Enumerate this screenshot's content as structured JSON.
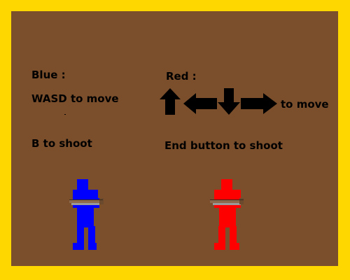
{
  "blue": {
    "heading": "Blue :",
    "move_text": "WASD to move",
    "shoot_text": "B to shoot",
    "color": "#0000FF"
  },
  "red": {
    "heading": "Red :",
    "move_text": "to move",
    "shoot_text": "End button to shoot",
    "color": "#FF0000",
    "arrow_icons": [
      "arrow-up-icon",
      "arrow-left-icon",
      "arrow-down-icon",
      "arrow-right-icon"
    ]
  },
  "colors": {
    "border": "#FFD700",
    "background": "#7B4F2C",
    "text": "#000000"
  }
}
